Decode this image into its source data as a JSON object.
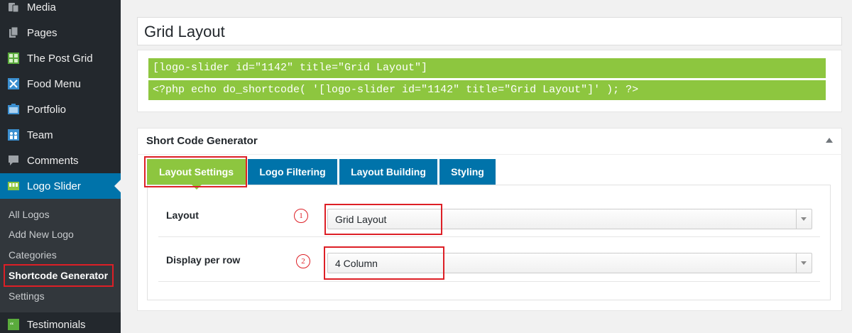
{
  "sidebar": {
    "items": [
      {
        "label": "Media",
        "icon": "media-icon"
      },
      {
        "label": "Pages",
        "icon": "pages-icon"
      },
      {
        "label": "The Post Grid",
        "icon": "post-grid-icon"
      },
      {
        "label": "Food Menu",
        "icon": "food-menu-icon"
      },
      {
        "label": "Portfolio",
        "icon": "portfolio-icon"
      },
      {
        "label": "Team",
        "icon": "team-icon"
      },
      {
        "label": "Comments",
        "icon": "comments-icon"
      },
      {
        "label": "Logo Slider",
        "icon": "logo-slider-icon"
      }
    ],
    "submenu": [
      "All Logos",
      "Add New Logo",
      "Categories",
      "Shortcode Generator",
      "Settings"
    ],
    "bottom_item": {
      "label": "Testimonials",
      "icon": "testimonials-icon"
    }
  },
  "post": {
    "title": "Grid Layout",
    "shortcode": "[logo-slider id=\"1142\" title=\"Grid Layout\"]",
    "php_code": "<?php echo do_shortcode( '[logo-slider id=\"1142\" title=\"Grid Layout\"]' ); ?>"
  },
  "generator": {
    "title": "Short Code Generator",
    "tabs": [
      "Layout Settings",
      "Logo Filtering",
      "Layout Building",
      "Styling"
    ],
    "fields": [
      {
        "label": "Layout",
        "value": "Grid Layout",
        "marker": "1"
      },
      {
        "label": "Display per row",
        "value": "4 Column",
        "marker": "2"
      }
    ]
  },
  "colors": {
    "sidebar_bg": "#23282d",
    "submenu_bg": "#32373c",
    "active_blue": "#0073aa",
    "accent_green": "#8dc63f",
    "highlight_red": "#dd1f26"
  }
}
